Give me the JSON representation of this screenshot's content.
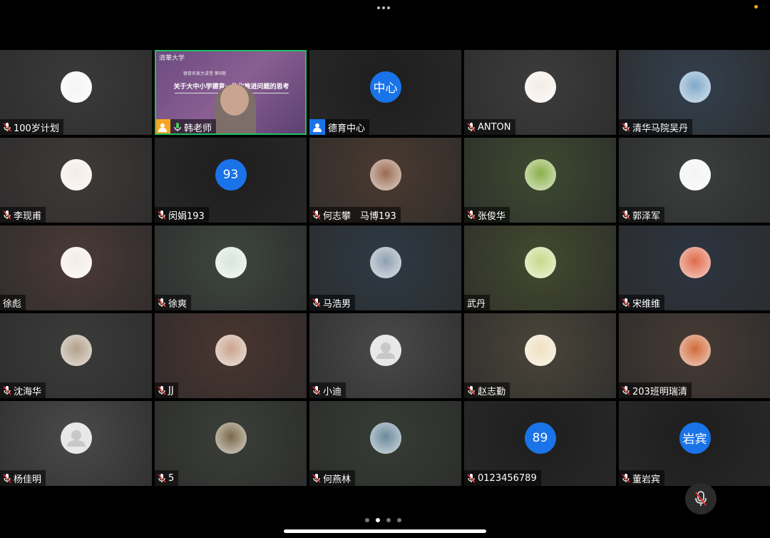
{
  "colors": {
    "accent": "#1a73e8",
    "speaker_border": "#1fbf5f",
    "status": "#f5a623"
  },
  "slide": {
    "logo_text": "清華大学",
    "subtitle": "德育名家大讲堂 第9期",
    "title": "关于大中小学德育一体化推进问题的思考"
  },
  "participants": [
    {
      "name": "100岁计划",
      "avatar": "logo-avatar",
      "muted": true,
      "bg": "#3a3a3a"
    },
    {
      "name": "韩老师",
      "avatar": "video",
      "muted": false,
      "bg": "#5a4070",
      "speaking": true
    },
    {
      "name": "德育中心",
      "avatar_text": "中心",
      "muted": false,
      "bg": "#1e1e1e",
      "host": true
    },
    {
      "name": "ANTON",
      "avatar": "cartoon-avatar",
      "muted": true,
      "bg": "#3c3c3c"
    },
    {
      "name": "清华马院吴丹",
      "avatar": "dandelion-avatar",
      "muted": true,
      "bg": "#34404e"
    },
    {
      "name": "李现甫",
      "avatar": "cartoon-avatar",
      "muted": true,
      "bg": "#3f3a38"
    },
    {
      "name": "闵娟193",
      "avatar_text": "93",
      "muted": true,
      "bg": "#1e1e1e"
    },
    {
      "name": "何志攀　马博193",
      "avatar": "photo-avatar",
      "muted": true,
      "bg": "#4a3a30"
    },
    {
      "name": "张俊华",
      "avatar": "fruit-avatar",
      "muted": true,
      "bg": "#3d4a30"
    },
    {
      "name": "郭泽军",
      "avatar": "sketch-avatar",
      "muted": true,
      "bg": "#3b3f3e"
    },
    {
      "name": "徐彪",
      "avatar": "cartoon-avatar",
      "muted": false,
      "bg": "#4a3a36"
    },
    {
      "name": "徐爽",
      "avatar": "girl-avatar",
      "muted": true,
      "bg": "#3e4640"
    },
    {
      "name": "马浩男",
      "avatar": "cat-avatar",
      "muted": true,
      "bg": "#2e3a44"
    },
    {
      "name": "武丹",
      "avatar": "kid-avatar",
      "muted": false,
      "bg": "#434a2e"
    },
    {
      "name": "宋维维",
      "avatar": "sunset-avatar",
      "muted": true,
      "bg": "#2d3540"
    },
    {
      "name": "沈海华",
      "avatar": "landscape-avatar",
      "muted": true,
      "bg": "#3a3c3a"
    },
    {
      "name": "JJ",
      "avatar": "person-avatar",
      "muted": true,
      "bg": "#4a3530"
    },
    {
      "name": "小迪",
      "avatar": "default-avatar",
      "muted": true,
      "bg": "#4a4a4a"
    },
    {
      "name": "赵志勤",
      "avatar": "text-image-avatar",
      "muted": true,
      "bg": "#4a453a"
    },
    {
      "name": "203班明瑞清",
      "avatar": "robot-avatar",
      "muted": true,
      "bg": "#463a34"
    },
    {
      "name": "杨佳明",
      "avatar": "default-avatar",
      "muted": true,
      "bg": "#4a4a4a"
    },
    {
      "name": "5",
      "avatar": "cow-avatar",
      "muted": true,
      "bg": "#3a3e38"
    },
    {
      "name": "何燕林",
      "avatar": "lake-avatar",
      "muted": true,
      "bg": "#363c34"
    },
    {
      "name": "0123456789",
      "avatar_text": "89",
      "muted": true,
      "bg": "#1e1e1e"
    },
    {
      "name": "董岩宾",
      "avatar_text": "岩宾",
      "muted": true,
      "bg": "#1e1e1e"
    }
  ],
  "pager": {
    "count": 4,
    "active": 2
  }
}
